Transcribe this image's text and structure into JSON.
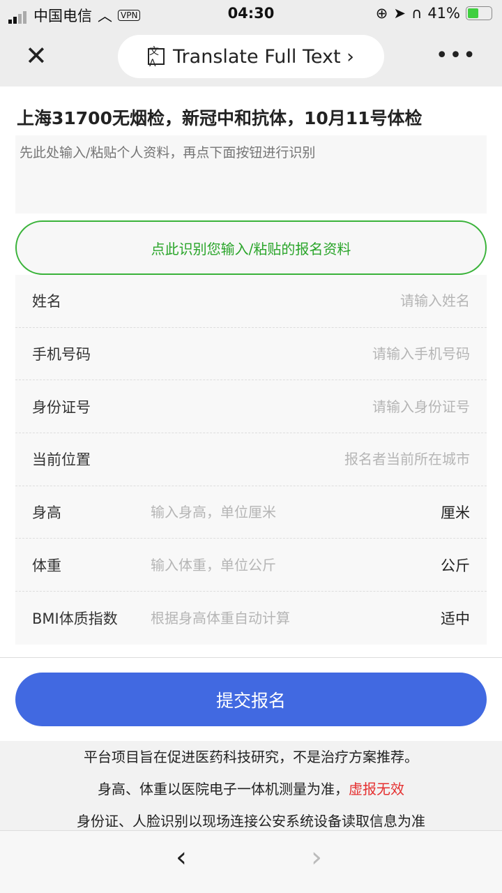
{
  "status": {
    "carrier": "中国电信",
    "vpn": "VPN",
    "time": "04:30",
    "battery": "41%",
    "battery_level": 0.41
  },
  "nav": {
    "translate_label": "Translate Full Text ›",
    "translate_icon": "文A"
  },
  "page": {
    "title": "上海31700无烟检，新冠中和抗体，10月11号体检",
    "paste_placeholder": "先此处输入/粘贴个人资料，再点下面按钮进行识别",
    "recognize_button": "点此识别您输入/粘贴的报名资料",
    "fields": [
      {
        "label": "姓名",
        "placeholder": "请输入姓名",
        "unit": ""
      },
      {
        "label": "手机号码",
        "placeholder": "请输入手机号码",
        "unit": ""
      },
      {
        "label": "身份证号",
        "placeholder": "请输入身份证号",
        "unit": ""
      },
      {
        "label": "当前位置",
        "placeholder": "报名者当前所在城市",
        "unit": ""
      },
      {
        "label": "身高",
        "placeholder": "输入身高，单位厘米",
        "unit": "厘米"
      },
      {
        "label": "体重",
        "placeholder": "输入体重，单位公斤",
        "unit": "公斤"
      },
      {
        "label": "BMI体质指数",
        "placeholder": "根据身高体重自动计算",
        "unit": "适中"
      }
    ],
    "submit": "提交报名",
    "notes": [
      "平台项目旨在促进医药科技研究，不是治疗方案推荐。",
      "身高、体重以医院电子一体机测量为准，",
      "虚报无效",
      "身份证、人脸识别以现场连接公安系统设备读取信息为准"
    ]
  },
  "colors": {
    "accent": "#4169e1",
    "green": "#3ab33a",
    "warning": "#e53030"
  }
}
